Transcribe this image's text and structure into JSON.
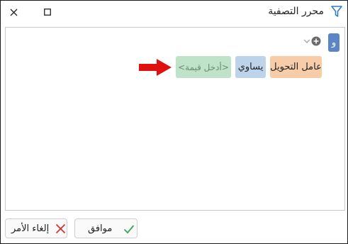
{
  "window": {
    "title": "محرر التصفية"
  },
  "icons": {
    "filter": "filter-icon",
    "close": "close-icon",
    "maximize": "maximize-icon",
    "add": "plus-circle-icon",
    "chevron": "chevron-down-icon",
    "arrow": "red-arrow-right-icon",
    "check": "check-icon",
    "cross": "x-icon"
  },
  "colors": {
    "and_chip": "#5b86c5",
    "field_chip": "#f7cda9",
    "operator_chip": "#bcd3ea",
    "value_chip": "#bfe3c9",
    "arrow": "#e01010",
    "check": "#3aa655",
    "cross": "#d9302f",
    "filter_icon": "#2f7ec1"
  },
  "filter": {
    "group_operator": "و",
    "condition": {
      "field": "عامل التحويل",
      "operator": "يساوي",
      "value_placeholder": "<أدخل قيمة>"
    }
  },
  "buttons": {
    "ok": "موافق",
    "cancel": "إلغاء الأمر"
  }
}
